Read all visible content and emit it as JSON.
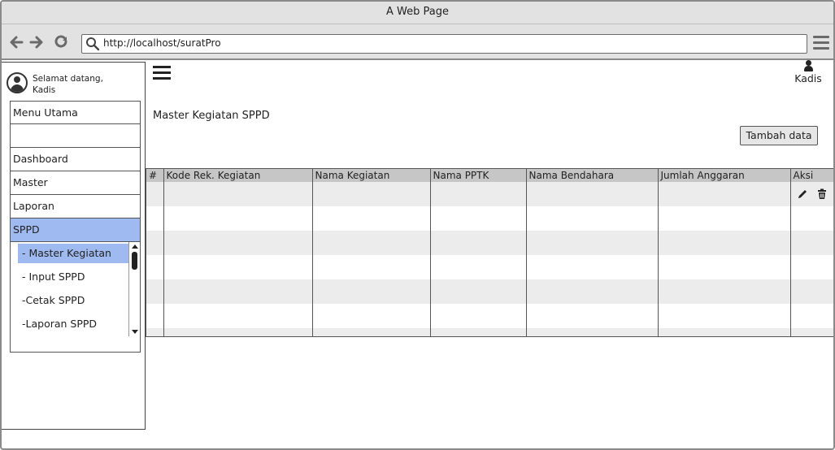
{
  "window": {
    "title": "A Web Page"
  },
  "browser": {
    "url": "http://localhost/suratPro"
  },
  "sidebar": {
    "welcome_line1": "Selamat datang,",
    "welcome_line2": "Kadis",
    "items": [
      {
        "label": "Menu Utama"
      },
      {
        "label": ""
      },
      {
        "label": "Dashboard"
      },
      {
        "label": "Master"
      },
      {
        "label": "Laporan"
      },
      {
        "label": "SPPD",
        "active": true
      }
    ],
    "submenu": [
      {
        "label": "- Master Kegiatan",
        "active": true
      },
      {
        "label": "- Input SPPD"
      },
      {
        "label": "-Cetak SPPD"
      },
      {
        "label": "-Laporan SPPD"
      }
    ]
  },
  "header": {
    "user_name": "Kadis"
  },
  "main": {
    "title": "Master Kegiatan SPPD",
    "add_button": "Tambah data"
  },
  "table": {
    "columns": [
      "#",
      "Kode Rek. Kegiatan",
      "Nama Kegiatan",
      "Nama PPTK",
      "Nama Bendahara",
      "Jumlah Anggaran",
      "Aksi"
    ],
    "rows": [
      [
        "",
        "",
        "",
        "",
        "",
        "",
        ""
      ],
      [
        "",
        "",
        "",
        "",
        "",
        "",
        ""
      ],
      [
        "",
        "",
        "",
        "",
        "",
        "",
        ""
      ],
      [
        "",
        "",
        "",
        "",
        "",
        "",
        ""
      ],
      [
        "",
        "",
        "",
        "",
        "",
        "",
        ""
      ],
      [
        "",
        "",
        "",
        "",
        "",
        "",
        ""
      ]
    ],
    "row_actions": [
      "edit-icon",
      "delete-icon"
    ]
  },
  "colors": {
    "accent": "#9fbaf0",
    "header_bg": "#c6c6c6",
    "stripe": "#ececec",
    "chrome": "#e2e2e2"
  }
}
